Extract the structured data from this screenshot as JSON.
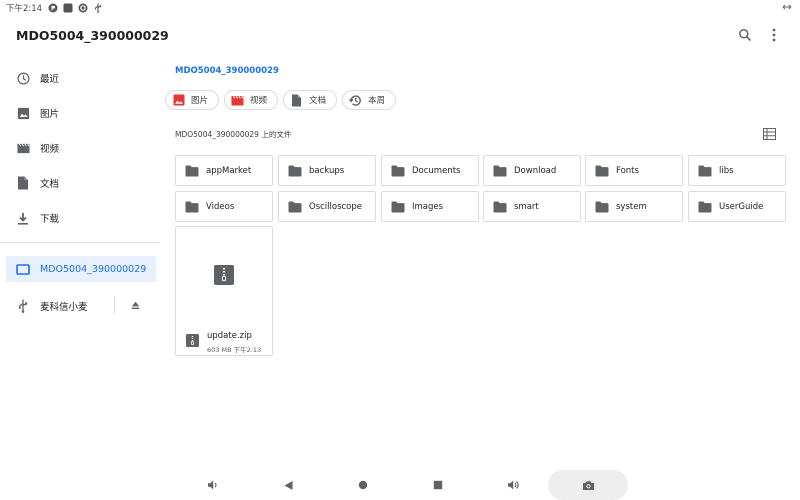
{
  "status_bar": {
    "time": "下午2:14"
  },
  "app_bar": {
    "title": "MDO5004_390000029",
    "search_icon": "search-icon",
    "more_icon": "more-vert-icon"
  },
  "sidebar": {
    "items": [
      {
        "label": "最近",
        "icon": "clock-icon"
      },
      {
        "label": "图片",
        "icon": "image-icon"
      },
      {
        "label": "视频",
        "icon": "video-icon"
      },
      {
        "label": "文档",
        "icon": "document-icon"
      },
      {
        "label": "下载",
        "icon": "download-icon"
      }
    ],
    "storage": [
      {
        "label": "MDO5004_390000029",
        "icon": "device-icon",
        "active": true
      },
      {
        "label": "麦科信小麦",
        "icon": "usb-icon",
        "active": false
      }
    ]
  },
  "main": {
    "breadcrumb": "MDO5004_390000029",
    "chips": [
      {
        "label": "图片",
        "icon": "image-icon",
        "color": "#e53935"
      },
      {
        "label": "视频",
        "icon": "video-icon",
        "color": "#e53935"
      },
      {
        "label": "文档",
        "icon": "document-icon",
        "color": "#5f6368"
      },
      {
        "label": "本周",
        "icon": "history-icon",
        "color": "#5f6368"
      }
    ],
    "section_label": "MDO5004_390000029 上的文件",
    "folders": [
      "appMarket",
      "backups",
      "Documents",
      "Download",
      "Fonts",
      "libs",
      "Videos",
      "Oscilloscope",
      "Images",
      "smart",
      "system",
      "UserGuide"
    ],
    "file": {
      "name": "update.zip",
      "meta": "603 MB 下午2:13",
      "icon": "zip-icon"
    }
  },
  "colors": {
    "accent": "#1a73e8",
    "active_bg": "#e8f0fe",
    "icon": "#5f6368"
  }
}
